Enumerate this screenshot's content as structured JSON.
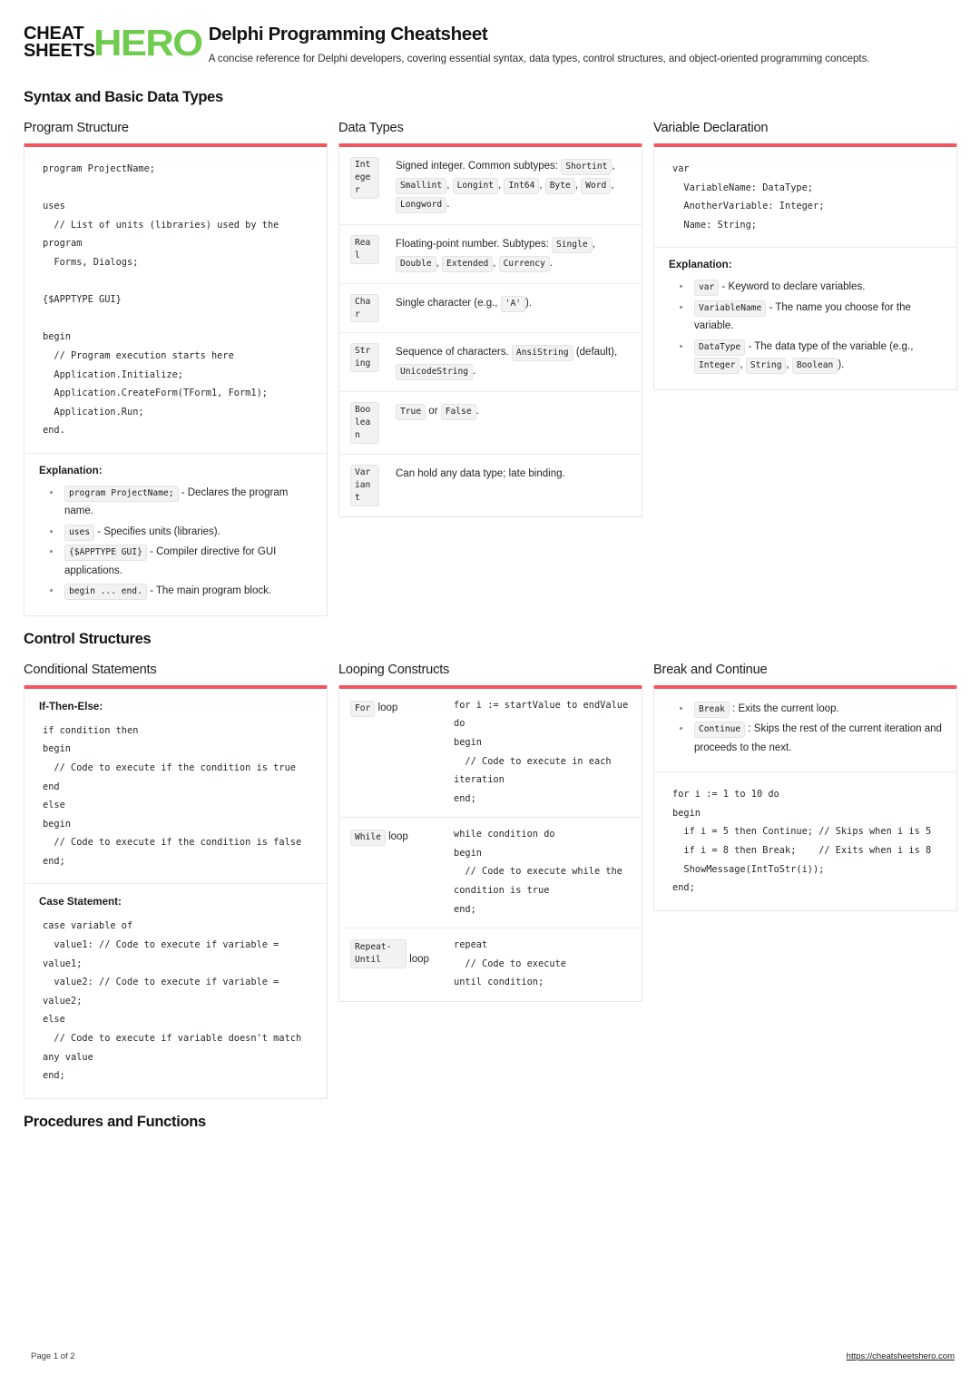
{
  "brand": {
    "line1": "CHEAT",
    "line2": "SHEETS",
    "hero": "HERO",
    "green": "#6fcc4f",
    "accent": "#f4555f"
  },
  "header": {
    "title": "Delphi Programming Cheatsheet",
    "subtitle": "A concise reference for Delphi developers, covering essential syntax, data types, control structures, and object-oriented programming concepts."
  },
  "sections": {
    "syntax": {
      "title": "Syntax and Basic Data Types",
      "program_structure": {
        "card_title": "Program Structure",
        "code": "program ProjectName;\n\nuses\n  // List of units (libraries) used by the program\n  Forms, Dialogs;\n\n{$APPTYPE GUI}\n\nbegin\n  // Program execution starts here\n  Application.Initialize;\n  Application.CreateForm(TForm1, Form1);\n  Application.Run;\nend.",
        "explanation_head": "Explanation:",
        "bullets": [
          {
            "code": "program ProjectName;",
            "text": " - Declares the program name."
          },
          {
            "code": "uses",
            "text": " - Specifies units (libraries)."
          },
          {
            "code": "{$APPTYPE GUI}",
            "text": " - Compiler directive for GUI applications."
          },
          {
            "code": "begin ... end.",
            "text": " - The main program block."
          }
        ]
      },
      "data_types": {
        "card_title": "Data Types",
        "rows": [
          {
            "type": "Integer",
            "parts": [
              {
                "kind": "text",
                "v": "Signed integer. Common subtypes: "
              },
              {
                "kind": "chip",
                "v": "Shortint"
              },
              {
                "kind": "text",
                "v": ", "
              },
              {
                "kind": "chip",
                "v": "Smallint"
              },
              {
                "kind": "text",
                "v": ", "
              },
              {
                "kind": "chip",
                "v": "Longint"
              },
              {
                "kind": "text",
                "v": ", "
              },
              {
                "kind": "chip",
                "v": "Int64"
              },
              {
                "kind": "text",
                "v": ", "
              },
              {
                "kind": "chip",
                "v": "Byte"
              },
              {
                "kind": "text",
                "v": ", "
              },
              {
                "kind": "chip",
                "v": "Word"
              },
              {
                "kind": "text",
                "v": ", "
              },
              {
                "kind": "chip",
                "v": "Longword"
              },
              {
                "kind": "text",
                "v": "."
              }
            ]
          },
          {
            "type": "Real",
            "parts": [
              {
                "kind": "text",
                "v": "Floating-point number. Subtypes: "
              },
              {
                "kind": "chip",
                "v": "Single"
              },
              {
                "kind": "text",
                "v": ", "
              },
              {
                "kind": "chip",
                "v": "Double"
              },
              {
                "kind": "text",
                "v": ", "
              },
              {
                "kind": "chip",
                "v": "Extended"
              },
              {
                "kind": "text",
                "v": ", "
              },
              {
                "kind": "chip",
                "v": "Currency"
              },
              {
                "kind": "text",
                "v": "."
              }
            ]
          },
          {
            "type": "Char",
            "parts": [
              {
                "kind": "text",
                "v": "Single character (e.g., "
              },
              {
                "kind": "chip",
                "v": "'A'"
              },
              {
                "kind": "text",
                "v": ")."
              }
            ]
          },
          {
            "type": "String",
            "parts": [
              {
                "kind": "text",
                "v": "Sequence of characters. "
              },
              {
                "kind": "chip",
                "v": "AnsiString"
              },
              {
                "kind": "text",
                "v": " (default), "
              },
              {
                "kind": "chip",
                "v": "UnicodeString"
              },
              {
                "kind": "text",
                "v": "."
              }
            ]
          },
          {
            "type": "Boolean",
            "parts": [
              {
                "kind": "chip",
                "v": "True"
              },
              {
                "kind": "text",
                "v": " or "
              },
              {
                "kind": "chip",
                "v": "False"
              },
              {
                "kind": "text",
                "v": "."
              }
            ]
          },
          {
            "type": "Variant",
            "parts": [
              {
                "kind": "text",
                "v": "Can hold any data type; late binding."
              }
            ]
          }
        ]
      },
      "variable_declaration": {
        "card_title": "Variable Declaration",
        "code": "var\n  VariableName: DataType;\n  AnotherVariable: Integer;\n  Name: String;",
        "explanation_head": "Explanation:",
        "bullets": [
          {
            "code": "var",
            "text": " - Keyword to declare variables."
          },
          {
            "code": "VariableName",
            "text": " - The name you choose for the variable."
          },
          {
            "code": "DataType",
            "text": " - The data type of the variable (e.g., ",
            "tail_chips": [
              "Integer",
              "String",
              "Boolean"
            ],
            "tail_text": ")."
          }
        ]
      }
    },
    "control": {
      "title": "Control Structures",
      "conditional": {
        "card_title": "Conditional Statements",
        "block1_head": "If-Then-Else:",
        "block1_code": "if condition then\nbegin\n  // Code to execute if the condition is true\nend\nelse\nbegin\n  // Code to execute if the condition is false\nend;",
        "block2_head": "Case Statement:",
        "block2_code": "case variable of\n  value1: // Code to execute if variable = value1;\n  value2: // Code to execute if variable = value2;\nelse\n  // Code to execute if variable doesn't match any value\nend;"
      },
      "looping": {
        "card_title": "Looping Constructs",
        "rows": [
          {
            "chip": "For",
            "label": " loop",
            "code": "for i := startValue to endValue do\nbegin\n  // Code to execute in each iteration\nend;"
          },
          {
            "chip": "While",
            "label": " loop",
            "code": "while condition do\nbegin\n  // Code to execute while the condition is true\nend;"
          },
          {
            "chip": "Repeat-Until",
            "label": " loop",
            "code": "repeat\n  // Code to execute\nuntil condition;"
          }
        ]
      },
      "break_continue": {
        "card_title": "Break and Continue",
        "bullets": [
          {
            "code": "Break",
            "text": " : Exits the current loop."
          },
          {
            "code": "Continue",
            "text": " : Skips the rest of the current iteration and proceeds to the next."
          }
        ],
        "code": "for i := 1 to 10 do\nbegin\n  if i = 5 then Continue; // Skips when i is 5\n  if i = 8 then Break;    // Exits when i is 8\n  ShowMessage(IntToStr(i));\nend;"
      }
    },
    "procedures": {
      "title": "Procedures and Functions"
    }
  },
  "footer": {
    "page": "Page 1 of 2",
    "url": "https://cheatsheetshero.com"
  }
}
